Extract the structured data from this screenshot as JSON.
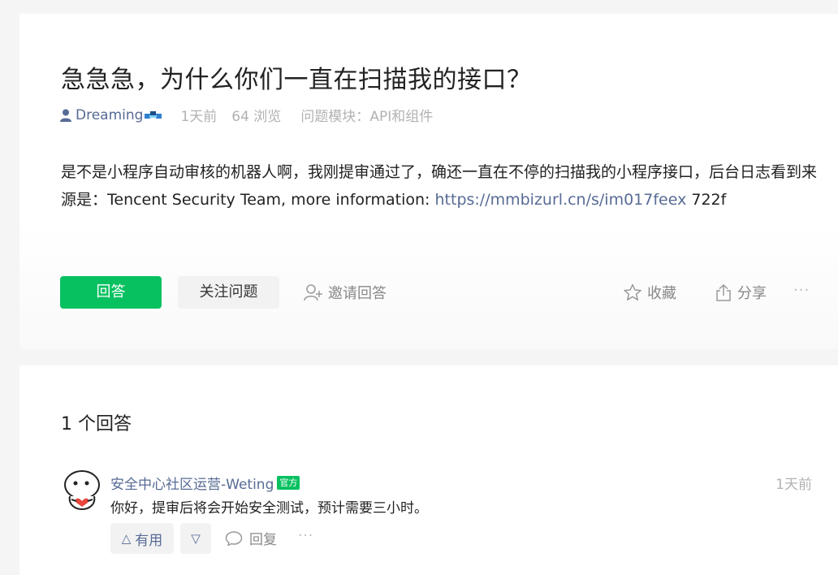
{
  "question": {
    "title": "急急急，为什么你们一直在扫描我的接口？",
    "author": "Dreaming",
    "time": "1天前",
    "views": "64 浏览",
    "module_label": "问题模块：",
    "module": "API和组件",
    "body_text": "是不是小程序自动审核的机器人啊，我刚提审通过了，确还一直在不停的扫描我的小程序接口，后台日志看到来源是：Tencent Security Team, more information: ",
    "body_link": "https://mmbizurl.cn/s/im017feex",
    "body_tail": " 722f"
  },
  "actions": {
    "answer": "回答",
    "follow": "关注问题",
    "invite": "邀请回答",
    "favorite": "收藏",
    "share": "分享",
    "more": "···"
  },
  "answers": {
    "count_label": "1 个回答",
    "items": [
      {
        "author": "安全中心社区运营-Weting",
        "badge": "官方",
        "time": "1天前",
        "text": "你好，提审后将会开始安全测试，预计需要三小时。",
        "useful": "有用",
        "reply": "回复",
        "more": "···"
      }
    ]
  },
  "icons": [
    "user-icon",
    "badge-icon",
    "invite-icon",
    "star-icon",
    "share-icon",
    "reply-icon",
    "avatar"
  ],
  "colors": {
    "accent": "#07c160",
    "link": "#576b95",
    "muted": "#b2b2b2"
  }
}
